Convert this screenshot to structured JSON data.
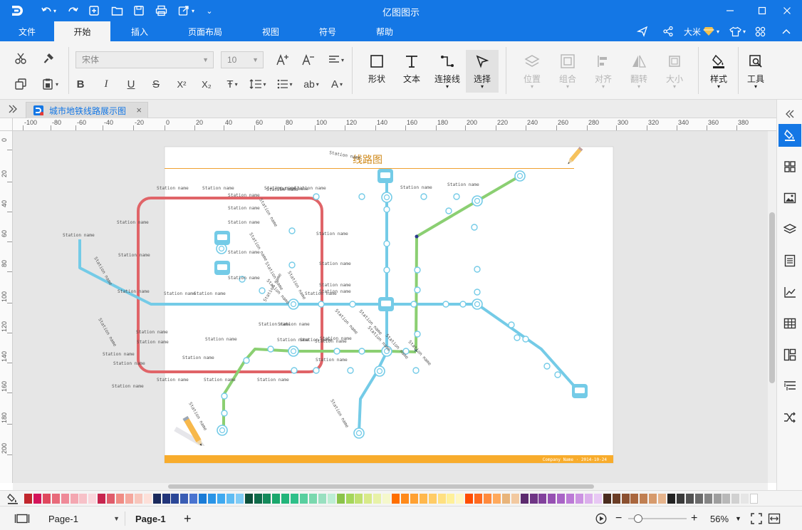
{
  "app": {
    "title": "亿图图示",
    "user": "大米"
  },
  "menu": {
    "tabs": [
      "文件",
      "开始",
      "插入",
      "页面布局",
      "视图",
      "符号",
      "帮助"
    ],
    "active": "开始"
  },
  "ribbon": {
    "font_name": "宋体",
    "font_size": "10",
    "tools": {
      "shape": "形状",
      "text": "文本",
      "connector": "连接线",
      "select": "选择",
      "position": "位置",
      "group": "组合",
      "align": "对齐",
      "rotate": "翻转",
      "size": "大小",
      "style": "样式",
      "tools": "工具"
    }
  },
  "document": {
    "tab_title": "城市地铁线路展示图"
  },
  "rulers": {
    "horizontal": [
      "-100",
      "-80",
      "-60",
      "-40",
      "-20",
      "0",
      "20",
      "40",
      "60",
      "80",
      "100",
      "120",
      "140",
      "160",
      "180",
      "200",
      "220",
      "240",
      "260",
      "280",
      "300",
      "320",
      "340",
      "360",
      "380"
    ],
    "vertical": [
      "0",
      "20",
      "40",
      "60",
      "80",
      "100",
      "120",
      "140",
      "160",
      "180",
      "200"
    ]
  },
  "diagram": {
    "title": "线路图",
    "footer": "Company Name · 2014-10-24",
    "station_label": "Station name",
    "colors": {
      "red_line": "#e06468",
      "blue_line": "#74cbe7",
      "green_line": "#8bcf72",
      "title": "#d08a1b",
      "footer_bar": "#f8ac2c"
    }
  },
  "palette": {
    "colors": [
      "#c1272d",
      "#d4145a",
      "#e0485e",
      "#e86a7a",
      "#ef8a98",
      "#f4a7b1",
      "#f7c1c8",
      "#fad6dc",
      "#c7254e",
      "#e05c6b",
      "#f08c84",
      "#f5a89e",
      "#f8c6bc",
      "#fde0d9",
      "#1b2a5c",
      "#22357a",
      "#2b4797",
      "#3a5db4",
      "#4a74d0",
      "#1a7bd6",
      "#2a94e6",
      "#3fa9f0",
      "#5fbcf3",
      "#80ccf6",
      "#0c4f3a",
      "#0f6b4a",
      "#148a5b",
      "#1aa76c",
      "#22b57a",
      "#2fc08a",
      "#58cf9f",
      "#7ad8ae",
      "#99e0c0",
      "#bdeed4",
      "#8bc34a",
      "#a5d65a",
      "#c0e070",
      "#d8ea8a",
      "#e8f2a8",
      "#f5f8cc",
      "#ff6f00",
      "#ff8a1a",
      "#ffa133",
      "#ffb84d",
      "#ffcc66",
      "#ffe080",
      "#fff099",
      "#fff7c2",
      "#ff4d00",
      "#ff6a1f",
      "#ff8a3d",
      "#ffa95c",
      "#e8b47a",
      "#f2c9a0",
      "#5c2a6e",
      "#6f3585",
      "#82419c",
      "#9650b2",
      "#a964c6",
      "#bc7ad6",
      "#cc93e2",
      "#dcafec",
      "#e8c8f4",
      "#4a2c1e",
      "#6b3d26",
      "#8b5030",
      "#a9663e",
      "#c07f52",
      "#d69a6c",
      "#e6b48c",
      "#222222",
      "#3a3a3a",
      "#525252",
      "#6b6b6b",
      "#858585",
      "#9e9e9e",
      "#b8b8b8",
      "#d1d1d1",
      "#e6e6e6",
      "#ffffff"
    ]
  },
  "status": {
    "page_select": "Page-1",
    "page_tab": "Page-1",
    "zoom": "56%",
    "zoom_level": 0.1
  }
}
